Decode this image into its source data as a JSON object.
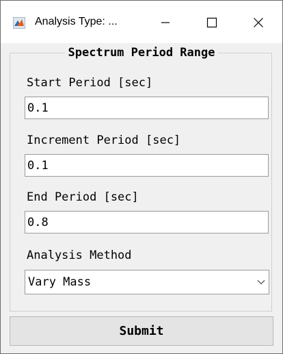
{
  "window": {
    "title": "Analysis Type: ...",
    "icon": "matlab-icon",
    "controls": {
      "minimize_icon": "minimize-icon",
      "maximize_icon": "maximize-icon",
      "close_icon": "close-icon"
    }
  },
  "panel": {
    "title": "Spectrum Period Range"
  },
  "fields": {
    "start_period": {
      "label": "Start Period [sec]",
      "value": "0.1"
    },
    "increment_period": {
      "label": "Increment Period [sec]",
      "value": "0.1"
    },
    "end_period": {
      "label": "End Period [sec]",
      "value": "0.8"
    }
  },
  "analysis_method": {
    "label": "Analysis Method",
    "selected": "Vary Mass"
  },
  "submit": {
    "label": "Submit"
  },
  "colors": {
    "window_bg": "#f0f0f0",
    "titlebar_bg": "#ffffff",
    "field_border": "#9a9a9a",
    "button_bg": "#e4e4e4"
  }
}
